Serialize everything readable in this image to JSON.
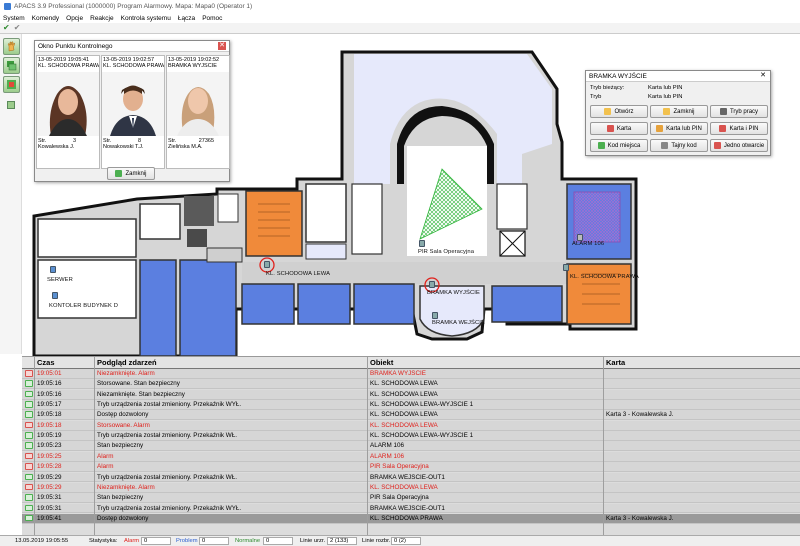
{
  "window": {
    "title": "APACS 3.9 Professional (1000000)  Program Alarmowy.  Mapa: Mapa0 (Operator 1)"
  },
  "menu": [
    "System",
    "Komendy",
    "Opcje",
    "Reakcje",
    "Kontrola systemu",
    "Łącza",
    "Pomoc"
  ],
  "colors": {
    "alarm_text": "#e0201b",
    "alarm_icon": "#d9534f",
    "ok_icon": "#4caf50",
    "room_blue": "#5b7fe0",
    "room_orange": "#f08a3a",
    "room_lavender": "#e6e9fb",
    "zone_green": "#3cc84a"
  },
  "map": {
    "labels": {
      "serwer": "SERWER",
      "kontroler": "KONTOLER BUDYNEK D",
      "kl_lewa": "KL. SCHODOWA LEWA",
      "pir": "PIR Sala Operacyjna",
      "bramka_wyjscie": "BRAMKA WYJŚCIE",
      "bramka_wejscie": "BRAMKA WEJŚCIE",
      "kl_prawa": "KL. SCHODOWA PRAWA",
      "alarm106": "ALARM 106"
    }
  },
  "checkpoint": {
    "title": "Okno Punktu Kontrolnego",
    "cells": [
      {
        "timestamp": "13-05-2019 19:05:41",
        "gate": "KL. SCHODOWA PRAWA",
        "nr_label": "Str.",
        "nr": "3",
        "name": "Kowalewska J."
      },
      {
        "timestamp": "13-05-2019 19:02:57",
        "gate": "KL. SCHODOWA PRAWA",
        "nr_label": "Str.",
        "nr": "8",
        "name": "Nowakowski T.J."
      },
      {
        "timestamp": "13-05-2019 19:02:52",
        "gate": "BRAMKA WYJŚCIE",
        "nr_label": "Str.",
        "nr": "27365",
        "name": "Zielińska M.A."
      }
    ],
    "close_label": "Zamknij"
  },
  "gate": {
    "title": "BRAMKA WYJŚCIE",
    "mode_current_label": "Tryb bieżący:",
    "mode_current_value": "Karta lub PIN",
    "mode_label": "Tryb",
    "mode_value": "Karta lub PIN",
    "buttons": [
      "Otwórz",
      "Zamknij",
      "Tryb pracy",
      "Karta",
      "Karta lub PIN",
      "Karta i PIN",
      "Kod miejsca",
      "Tajny kod",
      "Jedno otwarcie"
    ]
  },
  "events": {
    "columns": [
      "Czas",
      "Podgląd zdarzeń",
      "Obiekt",
      "Karta"
    ],
    "rows": [
      {
        "status": "alarm",
        "time": "19:05:01",
        "event": "Niezamknięte. Alarm",
        "object": "BRAMKA WYJŚCIE",
        "card": ""
      },
      {
        "status": "ok",
        "time": "19:05:16",
        "event": "Storsowane. Stan bezpieczny",
        "object": "KL. SCHODOWA LEWA",
        "card": ""
      },
      {
        "status": "ok",
        "time": "19:05:16",
        "event": "Niezamknięte. Stan bezpieczny",
        "object": "KL. SCHODOWA LEWA",
        "card": ""
      },
      {
        "status": "ok",
        "time": "19:05:17",
        "event": "Tryb urządzenia został zmieniony. Przekaźnik WYŁ.",
        "object": "KL. SCHODOWA LEWA-WYJŚCIE 1",
        "card": ""
      },
      {
        "status": "ok",
        "time": "19:05:18",
        "event": "Dostęp dozwolony",
        "object": "KL. SCHODOWA LEWA",
        "card": "Karta 3 - Kowalewska J."
      },
      {
        "status": "alarm",
        "time": "19:05:18",
        "event": "Storsowane. Alarm",
        "object": "KL. SCHODOWA LEWA",
        "card": ""
      },
      {
        "status": "ok",
        "time": "19:05:19",
        "event": "Tryb urządzenia został zmieniony. Przekaźnik WŁ.",
        "object": "KL. SCHODOWA LEWA-WYJŚCIE 1",
        "card": ""
      },
      {
        "status": "ok",
        "time": "19:05:23",
        "event": "Stan bezpieczny",
        "object": "ALARM 106",
        "card": ""
      },
      {
        "status": "alarm",
        "time": "19:05:25",
        "event": "Alarm",
        "object": "ALARM 106",
        "card": ""
      },
      {
        "status": "alarm",
        "time": "19:05:28",
        "event": "Alarm",
        "object": "PIR Sala Operacyjna",
        "card": ""
      },
      {
        "status": "ok",
        "time": "19:05:29",
        "event": "Tryb urządzenia został zmieniony. Przekaźnik WŁ.",
        "object": "BRAMKA WEJŚCIE-OUT1",
        "card": ""
      },
      {
        "status": "alarm",
        "time": "19:05:29",
        "event": "Niezamknięte. Alarm",
        "object": "KL. SCHODOWA LEWA",
        "card": ""
      },
      {
        "status": "ok",
        "time": "19:05:31",
        "event": "Stan bezpieczny",
        "object": "PIR Sala Operacyjna",
        "card": ""
      },
      {
        "status": "ok",
        "time": "19:05:31",
        "event": "Tryb urządzenia został zmieniony. Przekaźnik WYŁ.",
        "object": "BRAMKA WEJŚCIE-OUT1",
        "card": ""
      },
      {
        "status": "ok",
        "time": "19:05:41",
        "event": "Dostęp dozwolony",
        "object": "KL. SCHODOWA PRAWA",
        "card": "Karta 3 - Kowalewska J."
      }
    ]
  },
  "status": {
    "datetime": "13.05.2019 19:05:55",
    "stats_label": "Statystyka:",
    "alarm_label": "Alarm",
    "alarm_value": "0",
    "problem_label": "Problem",
    "problem_value": "0",
    "normal_label": "Normalne",
    "normal_value": "0",
    "lines_devices_label": "Linie urzr.",
    "lines_devices_value": "2 (133)",
    "lines_ext_label": "Linie rozbr.",
    "lines_ext_value": "0 (2)"
  }
}
